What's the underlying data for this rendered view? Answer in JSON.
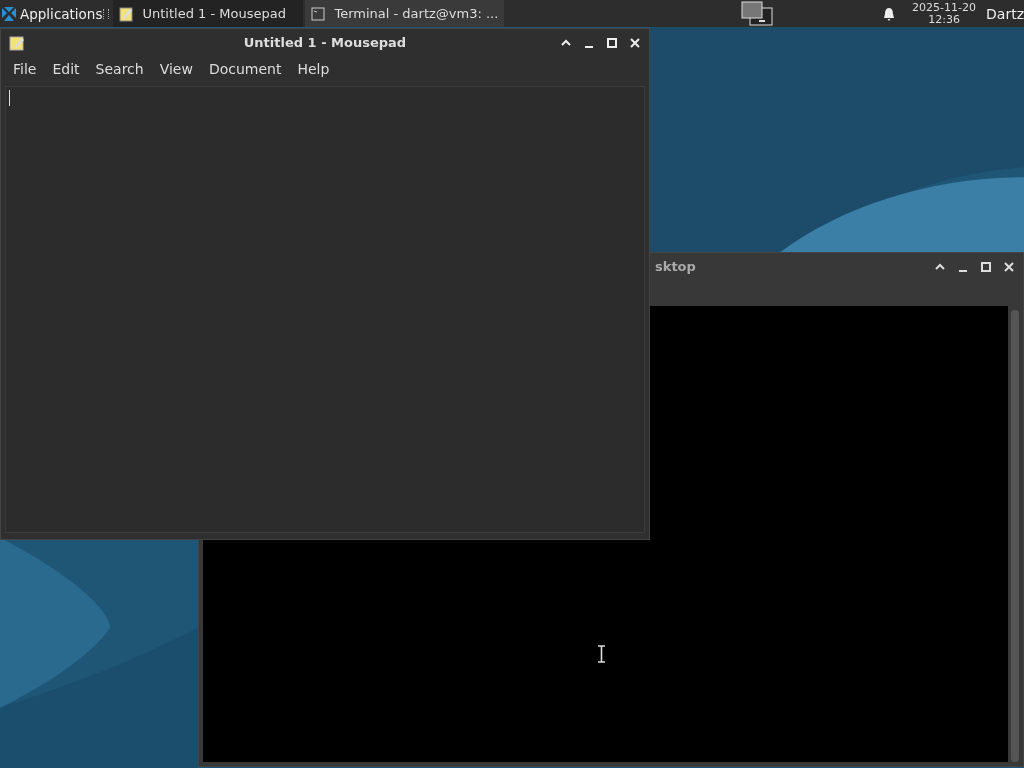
{
  "taskbar": {
    "menu_label": "Applications",
    "tasks": [
      {
        "label": "Untitled 1 - Mousepad",
        "kind": "editor",
        "selected": false
      },
      {
        "label": "Terminal - dartz@vm3: ...",
        "kind": "terminal",
        "selected": true
      }
    ],
    "clock": {
      "date": "2025-11-20",
      "time": "12:36"
    },
    "user": "Dartz"
  },
  "editor_window": {
    "title": "Untitled 1 - Mousepad",
    "menu": [
      "File",
      "Edit",
      "Search",
      "View",
      "Document",
      "Help"
    ]
  },
  "terminal_window": {
    "title": "sktop"
  }
}
